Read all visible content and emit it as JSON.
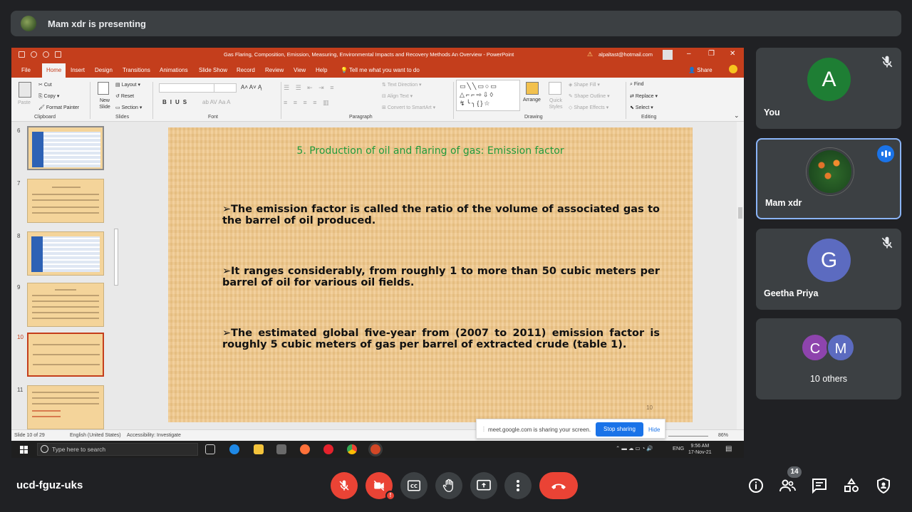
{
  "presenter": {
    "text": "Mam xdr is presenting"
  },
  "ppt": {
    "doc_title": "Gas Flaring, Composition, Emission, Measuring, Environmental Impacts and Recovery Methods An Overview  -  PowerPoint",
    "account": "alpaltast@hotmail.com",
    "tabs": [
      "File",
      "Home",
      "Insert",
      "Design",
      "Transitions",
      "Animations",
      "Slide Show",
      "Record",
      "Review",
      "View",
      "Help"
    ],
    "active_tab": "Home",
    "tell_me": "Tell me what you want to do",
    "share": "Share",
    "ribbon": {
      "paste": "Paste",
      "cut": "Cut",
      "copy": "Copy",
      "format_painter": "Format Painter",
      "new_slide": "New Slide",
      "layout": "Layout",
      "reset": "Reset",
      "section": "Section",
      "text_direction": "Text Direction",
      "align_text": "Align Text",
      "convert_smartart": "Convert to SmartArt",
      "arrange": "Arrange",
      "quick_styles": "Quick Styles",
      "shape_fill": "Shape Fill",
      "shape_outline": "Shape Outline",
      "shape_effects": "Shape Effects",
      "find": "Find",
      "replace": "Replace",
      "select": "Select",
      "groups": {
        "clipboard": "Clipboard",
        "slides": "Slides",
        "font": "Font",
        "paragraph": "Paragraph",
        "drawing": "Drawing",
        "editing": "Editing"
      }
    },
    "thumb_numbers": [
      "6",
      "7",
      "8",
      "9",
      "10",
      "11"
    ],
    "slide": {
      "title": "5. Production of oil and flaring of gas: Emission factor",
      "bullets": [
        "The emission factor is called the ratio of the volume of associated gas to the barrel of oil produced.",
        "It ranges considerably, from roughly 1 to more than 50 cubic meters per barrel of oil for various oil fields.",
        "The estimated global five-year from (2007 to 2011) emission factor is roughly 5 cubic meters of gas per barrel of extracted crude (table 1)."
      ],
      "bullet_mark": "➢",
      "number": "10"
    },
    "status": {
      "slide_of": "Slide 10 of 29",
      "language": "English (United States)",
      "accessibility": "Accessibility: Investigate",
      "zoom": "86%"
    }
  },
  "share_banner": {
    "message": "meet.google.com is sharing your screen.",
    "stop": "Stop sharing",
    "hide": "Hide"
  },
  "taskbar": {
    "search_placeholder": "Type here to search",
    "lang": "ENG",
    "time": "9:56 AM",
    "date": "17-Nov-21"
  },
  "participants": [
    {
      "name": "You",
      "initial": "A",
      "color": "#1e7e34",
      "muted": true
    },
    {
      "name": "Mam xdr",
      "speaking": true
    },
    {
      "name": "Geetha Priya",
      "initial": "G",
      "color": "#5c6bc0",
      "muted": true
    },
    {
      "name": "10 others",
      "initials": [
        "C",
        "M"
      ],
      "colors": [
        "#8e44ad",
        "#5c6bc0"
      ]
    }
  ],
  "meeting_code": "ucd-fguz-uks",
  "people_count": "14",
  "colors": {
    "end_call": "#ea4335",
    "accent": "#1a73e8",
    "ppt_brand": "#c43e1c"
  }
}
